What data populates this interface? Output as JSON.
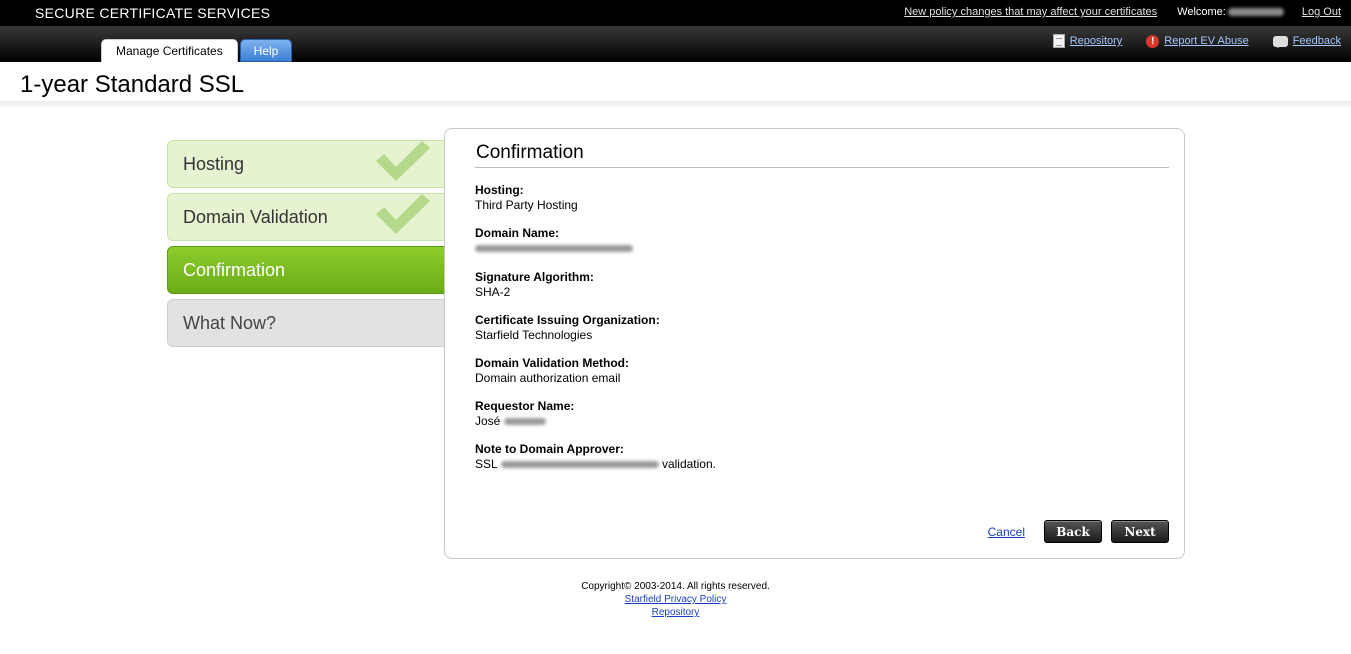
{
  "header": {
    "brand": "SECURE CERTIFICATE SERVICES",
    "policy_link": "New policy changes that may affect your certificates",
    "welcome_label": "Welcome:",
    "logout": "Log Out"
  },
  "tabs": {
    "manage": "Manage Certificates",
    "help": "Help"
  },
  "utility_links": {
    "repository": "Repository",
    "report_abuse": "Report EV Abuse",
    "feedback": "Feedback"
  },
  "page": {
    "title": "1-year Standard SSL"
  },
  "steps": [
    {
      "label": "Hosting",
      "status": "complete"
    },
    {
      "label": "Domain Validation",
      "status": "complete"
    },
    {
      "label": "Confirmation",
      "status": "active"
    },
    {
      "label": "What Now?",
      "status": "pending"
    }
  ],
  "confirmation": {
    "title": "Confirmation",
    "fields": {
      "hosting": {
        "label": "Hosting:",
        "value": "Third Party Hosting"
      },
      "domain_name": {
        "label": "Domain Name:",
        "value": ""
      },
      "signature_algorithm": {
        "label": "Signature Algorithm:",
        "value": "SHA-2"
      },
      "issuing_org": {
        "label": "Certificate Issuing Organization:",
        "value": "Starfield Technologies"
      },
      "validation_method": {
        "label": "Domain Validation Method:",
        "value": "Domain authorization email"
      },
      "requestor_name": {
        "label": "Requestor Name:",
        "value": "José"
      },
      "note": {
        "label": "Note to Domain Approver:",
        "value_prefix": "SSL",
        "value_suffix": "validation."
      }
    }
  },
  "actions": {
    "cancel": "Cancel",
    "back": "Back",
    "next": "Next"
  },
  "footer": {
    "copyright": "Copyright© 2003-2014. All rights reserved.",
    "privacy": "Starfield Privacy Policy",
    "repository": "Repository"
  },
  "colors": {
    "active_step": "#7bbd22",
    "complete_step": "#e5f3d0",
    "link": "#1a3fbf"
  }
}
